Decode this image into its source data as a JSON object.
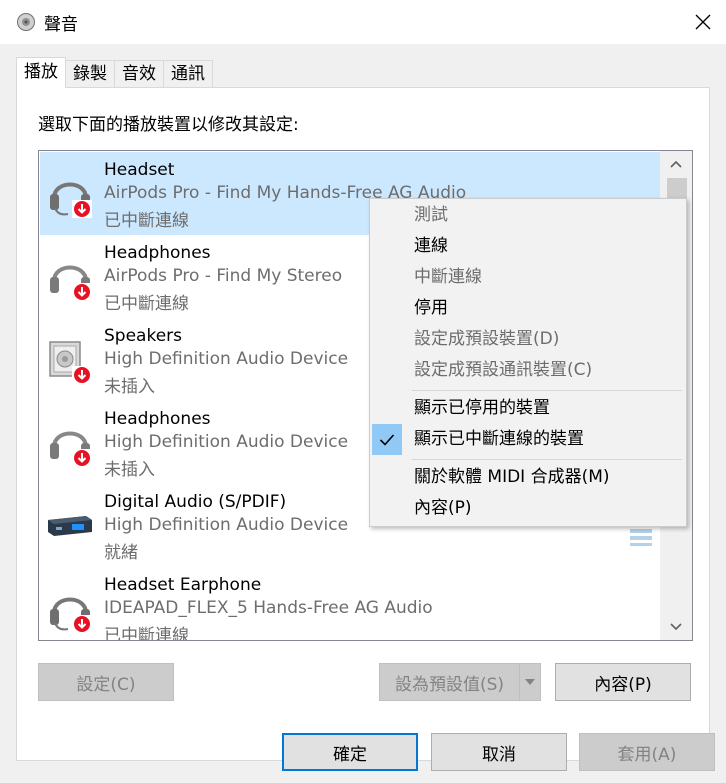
{
  "window": {
    "title": "聲音",
    "close_glyph": "✕"
  },
  "tabs": [
    {
      "label": "播放",
      "active": true
    },
    {
      "label": "錄製",
      "active": false
    },
    {
      "label": "音效",
      "active": false
    },
    {
      "label": "通訊",
      "active": false
    }
  ],
  "instruction": "選取下面的播放裝置以修改其設定:",
  "devices": [
    {
      "name": "Headset",
      "description": "AirPods Pro - Find My Hands-Free AG Audio",
      "status": "已中斷連線",
      "icon": "headset-icon",
      "selected": true
    },
    {
      "name": "Headphones",
      "description": "AirPods Pro - Find My Stereo",
      "status": "已中斷連線",
      "icon": "headphones-icon",
      "selected": false
    },
    {
      "name": "Speakers",
      "description": "High Definition Audio Device",
      "status": "未插入",
      "icon": "speaker-icon",
      "selected": false
    },
    {
      "name": "Headphones",
      "description": "High Definition Audio Device",
      "status": "未插入",
      "icon": "headphones-icon",
      "selected": false
    },
    {
      "name": "Digital Audio (S/PDIF)",
      "description": "High Definition Audio Device",
      "status": "就緒",
      "icon": "digital-audio-icon",
      "selected": false
    },
    {
      "name": "Headset Earphone",
      "description": "IDEAPAD_FLEX_5 Hands-Free AG Audio",
      "status": "已中斷連線",
      "icon": "headset-icon",
      "selected": false
    }
  ],
  "context_menu": {
    "items": [
      {
        "label": "測試",
        "enabled": false,
        "checked": false
      },
      {
        "label": "連線",
        "enabled": true,
        "checked": false
      },
      {
        "label": "中斷連線",
        "enabled": false,
        "checked": false
      },
      {
        "label": "停用",
        "enabled": true,
        "checked": false
      },
      {
        "label": "設定成預設裝置(D)",
        "enabled": false,
        "checked": false
      },
      {
        "label": "設定成預設通訊裝置(C)",
        "enabled": false,
        "checked": false
      },
      {
        "label": "顯示已停用的裝置",
        "enabled": true,
        "checked": false
      },
      {
        "label": "顯示已中斷連線的裝置",
        "enabled": true,
        "checked": true
      },
      {
        "label": "關於軟體 MIDI 合成器(M)",
        "enabled": true,
        "checked": false
      },
      {
        "label": "內容(P)",
        "enabled": true,
        "checked": false
      }
    ]
  },
  "panel_buttons": {
    "configure": "設定(C)",
    "set_default": "設為預設值(S)",
    "properties": "內容(P)"
  },
  "dialog_buttons": {
    "ok": "確定",
    "cancel": "取消",
    "apply": "套用(A)"
  },
  "colors": {
    "selection": "#cce8ff",
    "accent": "#0078d7",
    "disconnected_badge": "#e81123",
    "menu_check_bg": "#90c8f6"
  }
}
